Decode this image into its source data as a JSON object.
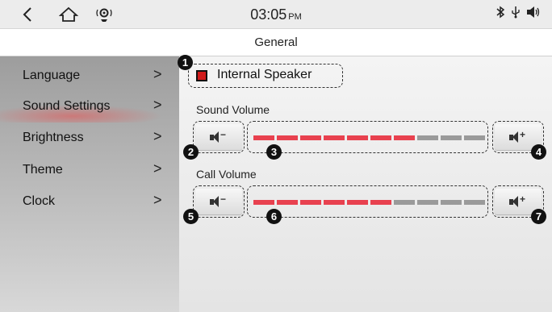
{
  "status_bar": {
    "time": "03:05",
    "ampm": "PM",
    "bluetooth_icon": "bluetooth-icon",
    "usb_icon": "usb-icon",
    "volume_icon": "speaker-icon"
  },
  "header": {
    "title": "General"
  },
  "sidebar": {
    "items": [
      {
        "label": "Language",
        "chevron": ">"
      },
      {
        "label": "Sound Settings",
        "chevron": ">"
      },
      {
        "label": "Brightness",
        "chevron": ">"
      },
      {
        "label": "Theme",
        "chevron": ">"
      },
      {
        "label": "Clock",
        "chevron": ">"
      }
    ]
  },
  "main": {
    "internal_speaker": {
      "label": "Internal Speaker",
      "checked": true
    },
    "sound_volume": {
      "label": "Sound Volume",
      "level": 7,
      "max": 10,
      "minus": "−",
      "plus": "+"
    },
    "call_volume": {
      "label": "Call Volume",
      "level": 6,
      "max": 10,
      "minus": "−",
      "plus": "+"
    },
    "callouts": [
      "1",
      "2",
      "3",
      "4",
      "5",
      "6",
      "7"
    ]
  },
  "colors": {
    "active_segment": "#e8414f",
    "inactive_segment": "#9a9a9a",
    "checkbox_fill": "#d11b1b"
  }
}
